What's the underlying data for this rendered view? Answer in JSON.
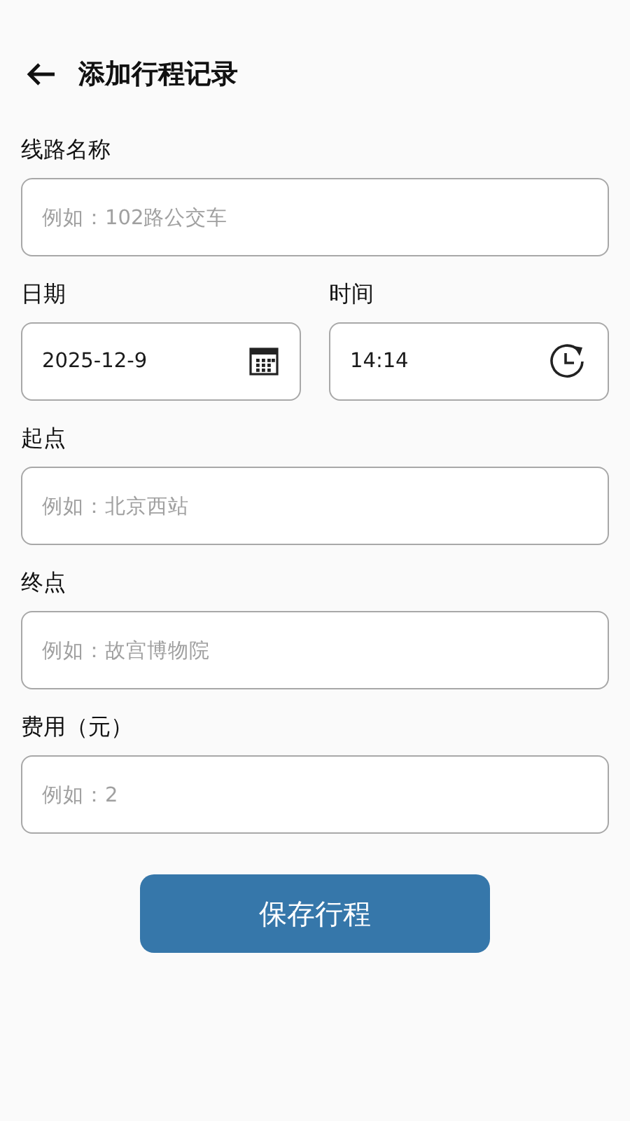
{
  "header": {
    "title": "添加行程记录"
  },
  "rows": [
    {
      "fields": [
        {
          "kind": "text",
          "label": "线路名称",
          "placeholder": "例如：102路公交车"
        }
      ]
    },
    {
      "fields": [
        {
          "kind": "date",
          "label": "日期",
          "value": "2025-12-9"
        },
        {
          "kind": "time",
          "label": "时间",
          "value": "14:14"
        }
      ]
    },
    {
      "fields": [
        {
          "kind": "text",
          "label": "起点",
          "placeholder": "例如：北京西站"
        }
      ]
    },
    {
      "fields": [
        {
          "kind": "text",
          "label": "终点",
          "placeholder": "例如：故宫博物院"
        }
      ]
    },
    {
      "fields": [
        {
          "kind": "text",
          "label": "费用（元）",
          "placeholder": "例如：2"
        }
      ]
    }
  ],
  "save_button": "保存行程"
}
